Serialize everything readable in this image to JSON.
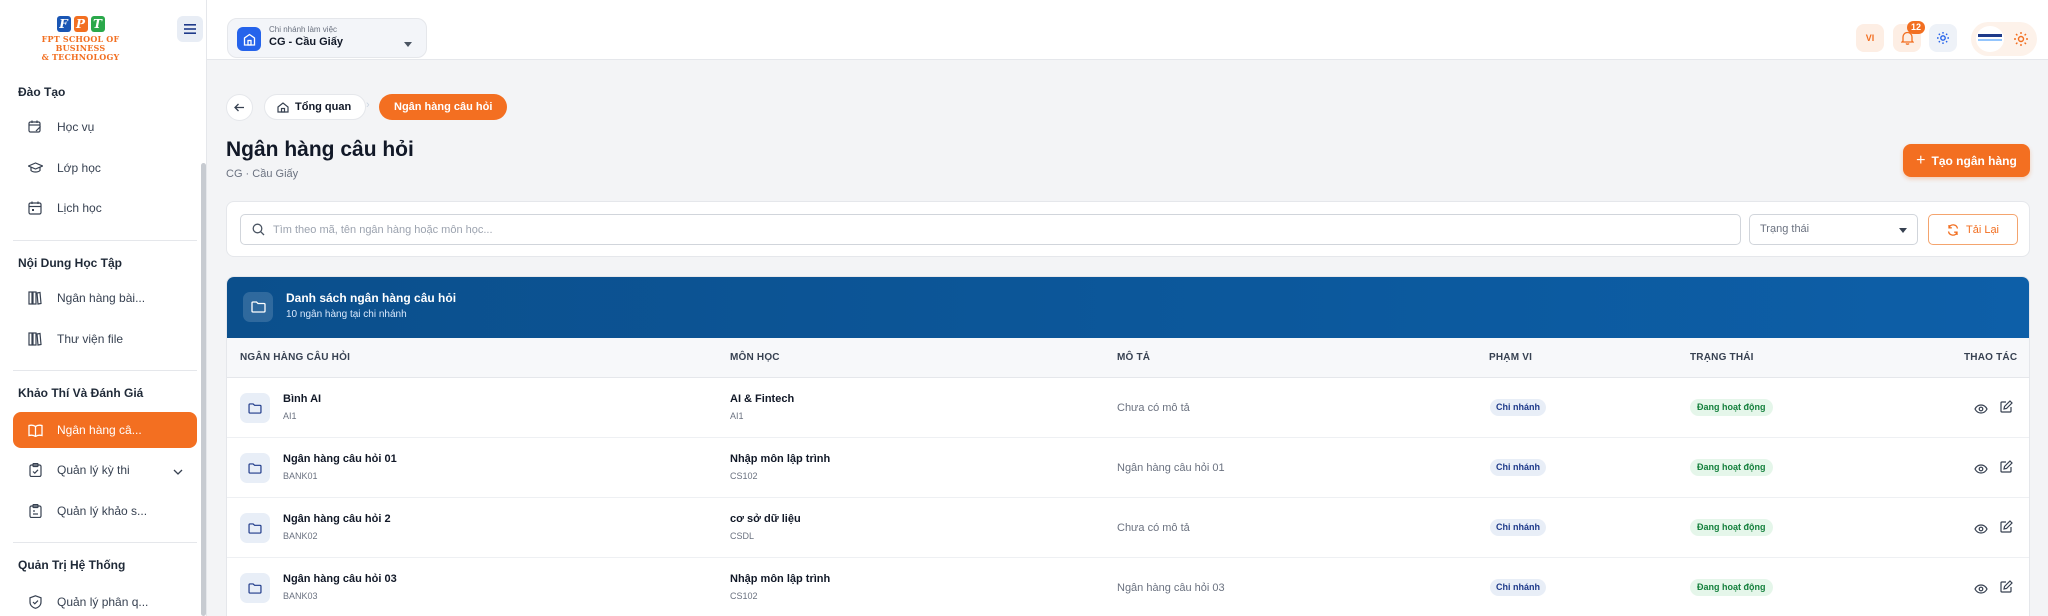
{
  "logo": {
    "letters": [
      "F",
      "P",
      "T"
    ],
    "line1": "FPT SCHOOL OF BUSINESS",
    "line2": "& TECHNOLOGY",
    "colors": [
      "#1a56b4",
      "#f26f21",
      "#2aa84a"
    ]
  },
  "sidebar": {
    "sections": [
      {
        "title": "Đào Tạo",
        "items": [
          {
            "label": "Học vụ",
            "icon": "calendar-edit-icon"
          },
          {
            "label": "Lớp học",
            "icon": "graduation-cap-icon"
          },
          {
            "label": "Lịch học",
            "icon": "calendar-icon"
          }
        ]
      },
      {
        "title": "Nội Dung Học Tập",
        "items": [
          {
            "label": "Ngân hàng bài...",
            "icon": "library-icon"
          },
          {
            "label": "Thư viện file",
            "icon": "library-icon"
          }
        ]
      },
      {
        "title": "Khảo Thí Và Đánh Giá",
        "items": [
          {
            "label": "Ngân hàng câ...",
            "icon": "book-open-icon",
            "active": true
          },
          {
            "label": "Quản lý kỳ thi",
            "icon": "clipboard-check-icon"
          },
          {
            "label": "Quản lý khảo s...",
            "icon": "clipboard-list-icon"
          }
        ]
      },
      {
        "title": "Quản Trị Hệ Thống",
        "items": [
          {
            "label": "Quản lý phân q...",
            "icon": "shield-check-icon"
          }
        ]
      }
    ]
  },
  "topbar": {
    "branch_label": "Chi nhánh làm việc",
    "branch_value": "CG - Cầu Giấy",
    "lang": "VI",
    "notification_count": "12"
  },
  "breadcrumb": {
    "home": "Tổng quan",
    "current": "Ngân hàng câu hỏi"
  },
  "page": {
    "title": "Ngân hàng câu hỏi",
    "subtitle": "CG · Cầu Giấy",
    "create_label": "Tạo ngân hàng"
  },
  "filters": {
    "search_placeholder": "Tìm theo mã, tên ngân hàng hoặc môn học...",
    "status_placeholder": "Trạng thái",
    "reload_label": "Tải Lại"
  },
  "table": {
    "title": "Danh sách ngân hàng câu hỏi",
    "subtitle": "10 ngân hàng tại chi nhánh",
    "columns": [
      "NGÂN HÀNG CÂU HỎI",
      "MÔN HỌC",
      "MÔ TẢ",
      "PHẠM VI",
      "TRẠNG THÁI",
      "THAO TÁC"
    ],
    "rows": [
      {
        "name": "Bình AI",
        "code": "AI1",
        "subject": "AI & Fintech",
        "subject_code": "AI1",
        "description": "Chưa có mô tả",
        "scope": "Chi nhánh",
        "status": "Đang hoạt động"
      },
      {
        "name": "Ngân hàng câu hỏi 01",
        "code": "BANK01",
        "subject": "Nhập môn lập trình",
        "subject_code": "CS102",
        "description": "Ngân hàng câu hỏi 01",
        "scope": "Chi nhánh",
        "status": "Đang hoạt động"
      },
      {
        "name": "Ngân hàng câu hỏi 2",
        "code": "BANK02",
        "subject": "cơ sở dữ liệu",
        "subject_code": "CSDL",
        "description": "Chưa có mô tả",
        "scope": "Chi nhánh",
        "status": "Đang hoạt động"
      },
      {
        "name": "Ngân hàng câu hỏi 03",
        "code": "BANK03",
        "subject": "Nhập môn lập trình",
        "subject_code": "CS102",
        "description": "Ngân hàng câu hỏi 03",
        "scope": "Chi nhánh",
        "status": "Đang hoạt động"
      }
    ]
  },
  "colors": {
    "accent": "#f36f21",
    "primary": "#0b4f8c",
    "success": "#15803d"
  }
}
